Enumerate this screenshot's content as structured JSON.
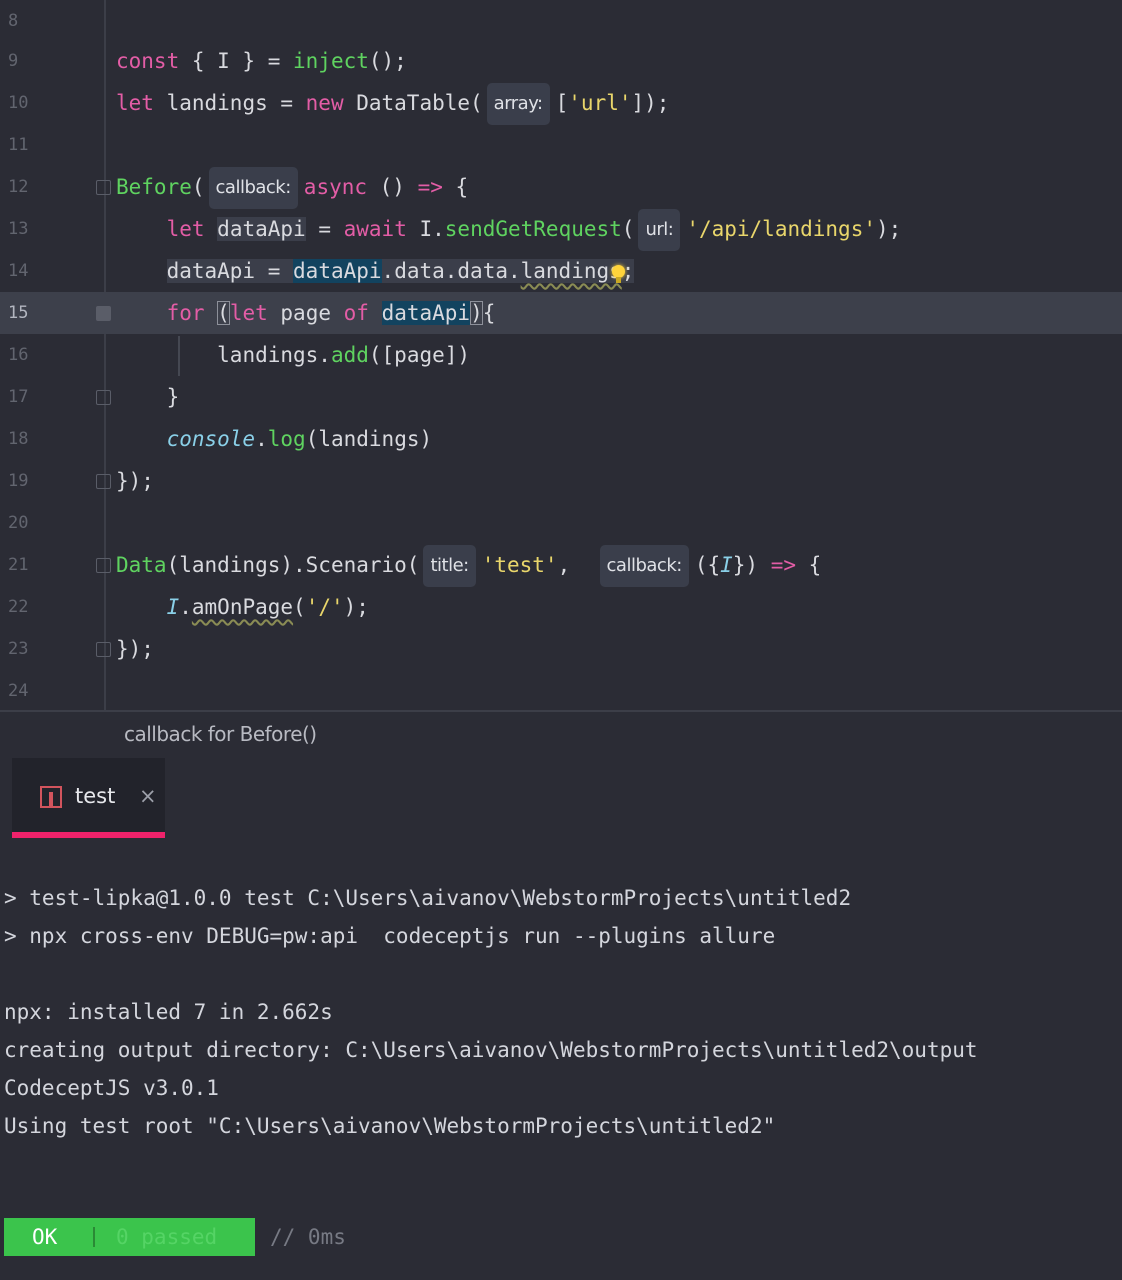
{
  "editor": {
    "lines": [
      {
        "n": "8"
      },
      {
        "n": "9"
      },
      {
        "n": "10"
      },
      {
        "n": "11"
      },
      {
        "n": "12"
      },
      {
        "n": "13"
      },
      {
        "n": "14"
      },
      {
        "n": "15"
      },
      {
        "n": "16"
      },
      {
        "n": "17"
      },
      {
        "n": "18"
      },
      {
        "n": "19"
      },
      {
        "n": "20"
      },
      {
        "n": "21"
      },
      {
        "n": "22"
      },
      {
        "n": "23"
      },
      {
        "n": "24"
      }
    ],
    "tokens": {
      "const": "const",
      "destructure": " { I } = ",
      "inject": "inject",
      "call_end": "();",
      "let": "let",
      "landings_decl": " landings = ",
      "new": "new",
      "datatable": " DataTable(",
      "hint_array": "array:",
      "url_array_open": "[",
      "url_str": "'url'",
      "url_array_close": "]);",
      "before": "Before",
      "paren_open": "(",
      "hint_callback": "callback:",
      "async": "async",
      "arrow_params": " () ",
      "arrow": "=>",
      "brace_open": " {",
      "let2": "let",
      "dataapi_decl": "dataApi",
      "assign": " = ",
      "await": "await",
      "i_dot": " I.",
      "sendget": "sendGetRequest",
      "hint_url": "url:",
      "api_str": "'/api/landings'",
      "stmt_end": ");",
      "dataapi_lhs": "dataApi",
      "assign2": " = ",
      "dataapi_rhs": "dataApi",
      "data_chain": ".data.data.",
      "landings_prop": "landings",
      "semi": ";",
      "for": "for",
      "space": " ",
      "lparen": "(",
      "let3": "let",
      "page_var": " page ",
      "of": "of",
      "space2": " ",
      "dataapi_iter": "dataApi",
      "rparen": ")",
      "loop_brace": "{",
      "landings_obj": "landings.",
      "add": "add",
      "add_args": "([page])",
      "close_brace": "}",
      "console": "console",
      "dot": ".",
      "log": "log",
      "log_args": "(landings)",
      "close_before": "});",
      "data_fn": "Data",
      "data_args": "(landings).Scenario(",
      "hint_title": "title:",
      "test_str": "'test'",
      "comma": ",",
      "hint_callback2": "callback:",
      "scenario_params_open": "({",
      "i_param": "I",
      "scenario_params_close": "}) ",
      "arrow2": "=>",
      "brace_open2": " {",
      "i_call": "I",
      "amonpage_dot": ".",
      "amonpage": "amOnPage",
      "amonpage_open": "(",
      "slash_str": "'/'",
      "amonpage_close": ");",
      "close_scenario": "});"
    }
  },
  "breadcrumb": "callback for Before()",
  "run_tab": {
    "label": "test",
    "close": "×"
  },
  "console": {
    "lines": [
      "> test-lipka@1.0.0 test C:\\Users\\aivanov\\WebstormProjects\\untitled2",
      "> npx cross-env DEBUG=pw:api  codeceptjs run --plugins allure",
      "npx: installed 7 in 2.662s",
      "creating output directory: C:\\Users\\aivanov\\WebstormProjects\\untitled2\\output",
      "CodeceptJS v3.0.1",
      "Using test root \"C:\\Users\\aivanov\\WebstormProjects\\untitled2\""
    ],
    "result": {
      "ok": "OK",
      "passed": "0 passed",
      "duration": "// 0ms"
    }
  },
  "colors": {
    "accent": "#f0226b",
    "ok": "#3bc44c",
    "keyword": "#e35da6",
    "function": "#5fd360",
    "string": "#e9d66b"
  }
}
